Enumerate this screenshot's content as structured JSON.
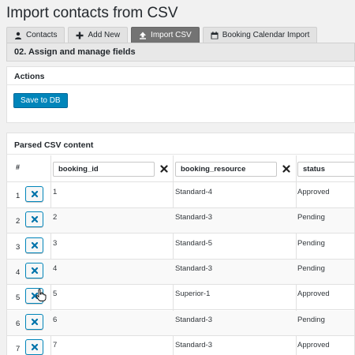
{
  "page": {
    "title": "Import contacts from CSV"
  },
  "tabs": [
    {
      "label": "Contacts",
      "icon": "person-icon",
      "active": false
    },
    {
      "label": "Add New",
      "icon": "plus-icon",
      "active": false
    },
    {
      "label": "Import CSV",
      "icon": "upload-icon",
      "active": true
    },
    {
      "label": "Booking Calendar Import",
      "icon": "calendar-icon",
      "active": false
    }
  ],
  "section": {
    "title": "02. Assign and manage fields"
  },
  "actions": {
    "title": "Actions",
    "save_label": "Save to DB"
  },
  "csv": {
    "title": "Parsed CSV content",
    "hash_label": "#",
    "columns": [
      "booking_id",
      "booking_resource",
      "status"
    ],
    "rows": [
      {
        "num": "1",
        "cells": [
          "1",
          "Standard-4",
          "Approved"
        ]
      },
      {
        "num": "2",
        "cells": [
          "2",
          "Standard-3",
          "Pending"
        ]
      },
      {
        "num": "3",
        "cells": [
          "3",
          "Standard-5",
          "Pending"
        ]
      },
      {
        "num": "4",
        "cells": [
          "4",
          "Standard-3",
          "Pending"
        ]
      },
      {
        "num": "5",
        "cells": [
          "5",
          "Superior-1",
          "Approved"
        ]
      },
      {
        "num": "6",
        "cells": [
          "6",
          "Standard-3",
          "Pending"
        ]
      },
      {
        "num": "7",
        "cells": [
          "7",
          "Standard-3",
          "Approved"
        ]
      }
    ]
  },
  "colors": {
    "accent": "#0085ba",
    "active_tab": "#737373",
    "remove_icon": "#222222",
    "row_remove_icon": "#0073aa"
  }
}
